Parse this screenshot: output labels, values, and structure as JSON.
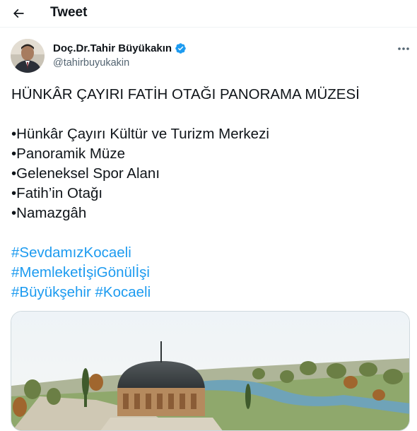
{
  "header": {
    "title": "Tweet",
    "back_icon": "back-arrow-icon"
  },
  "author": {
    "name": "Doç.Dr.Tahir Büyükakın",
    "handle": "@tahirbuyukakin",
    "verified_icon": "verified-badge-icon",
    "verified_color": "#1d9bf0"
  },
  "more_icon": "more-options-icon",
  "tweet": {
    "headline": "HÜNKÂR ÇAYIRI FATİH OTAĞI PANORAMA MÜZESİ",
    "bullets": [
      "•Hünkâr Çayırı Kültür ve Turizm Merkezi",
      "•Panoramik Müze",
      "•Geleneksel Spor Alanı",
      "•Fatih’in Otağı",
      "•Namazgâh"
    ],
    "hashtags": {
      "line1": "#SevdamızKocaeli",
      "line2": "#MemleketİşiGönülİşi",
      "line3a": "#Büyükşehir",
      "line3b": "#Kocaeli"
    }
  },
  "colors": {
    "text": "#0f1419",
    "secondary": "#536471",
    "link": "#1d9bf0",
    "border": "#cfd9de"
  }
}
